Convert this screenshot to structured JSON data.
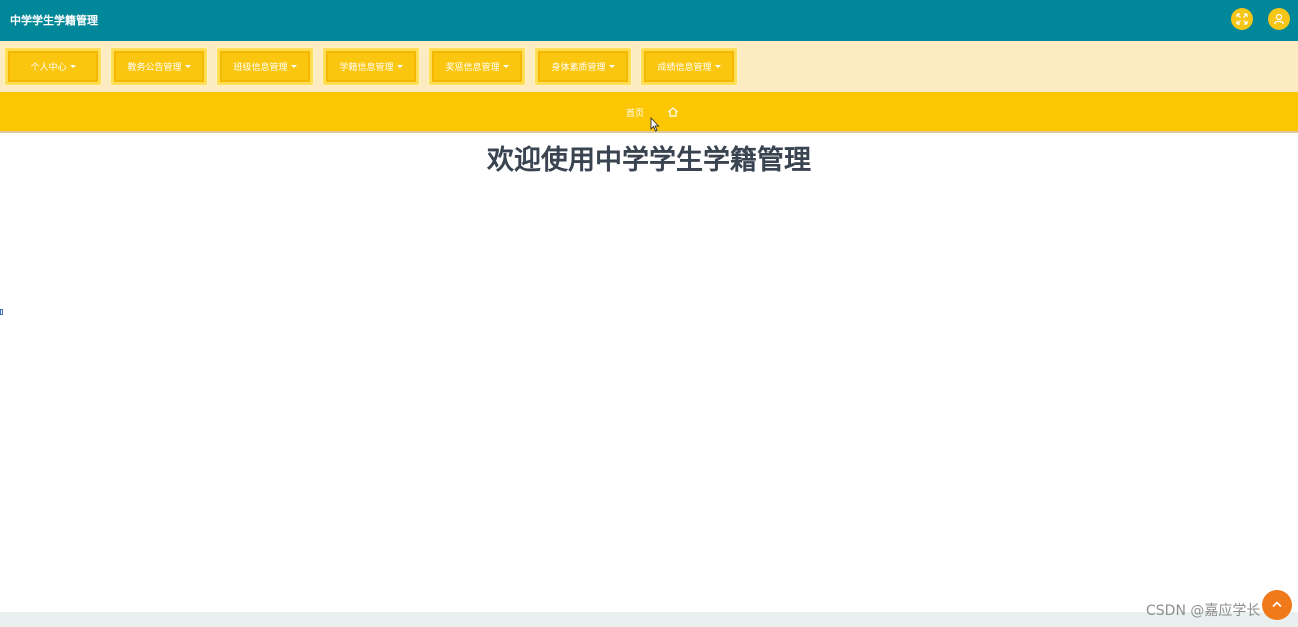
{
  "header": {
    "app_title": "中学学生学籍管理",
    "fullscreen_icon": "fullscreen-icon",
    "user_icon": "user-icon",
    "colors": {
      "topbar": "#00879a",
      "accent": "#fcc702"
    }
  },
  "menu": {
    "items": [
      {
        "label": "个人中心"
      },
      {
        "label": "教务公告管理"
      },
      {
        "label": "班级信息管理"
      },
      {
        "label": "学籍信息管理"
      },
      {
        "label": "奖惩信息管理"
      },
      {
        "label": "身体素质管理"
      },
      {
        "label": "成绩信息管理"
      }
    ]
  },
  "breadcrumb": {
    "home_label": "首页",
    "home_icon": "home-icon"
  },
  "main": {
    "welcome": "欢迎使用中学学生学籍管理"
  },
  "watermark": {
    "text": "CSDN @嘉应学长"
  },
  "back_to_top_icon": "arrow-up-icon"
}
